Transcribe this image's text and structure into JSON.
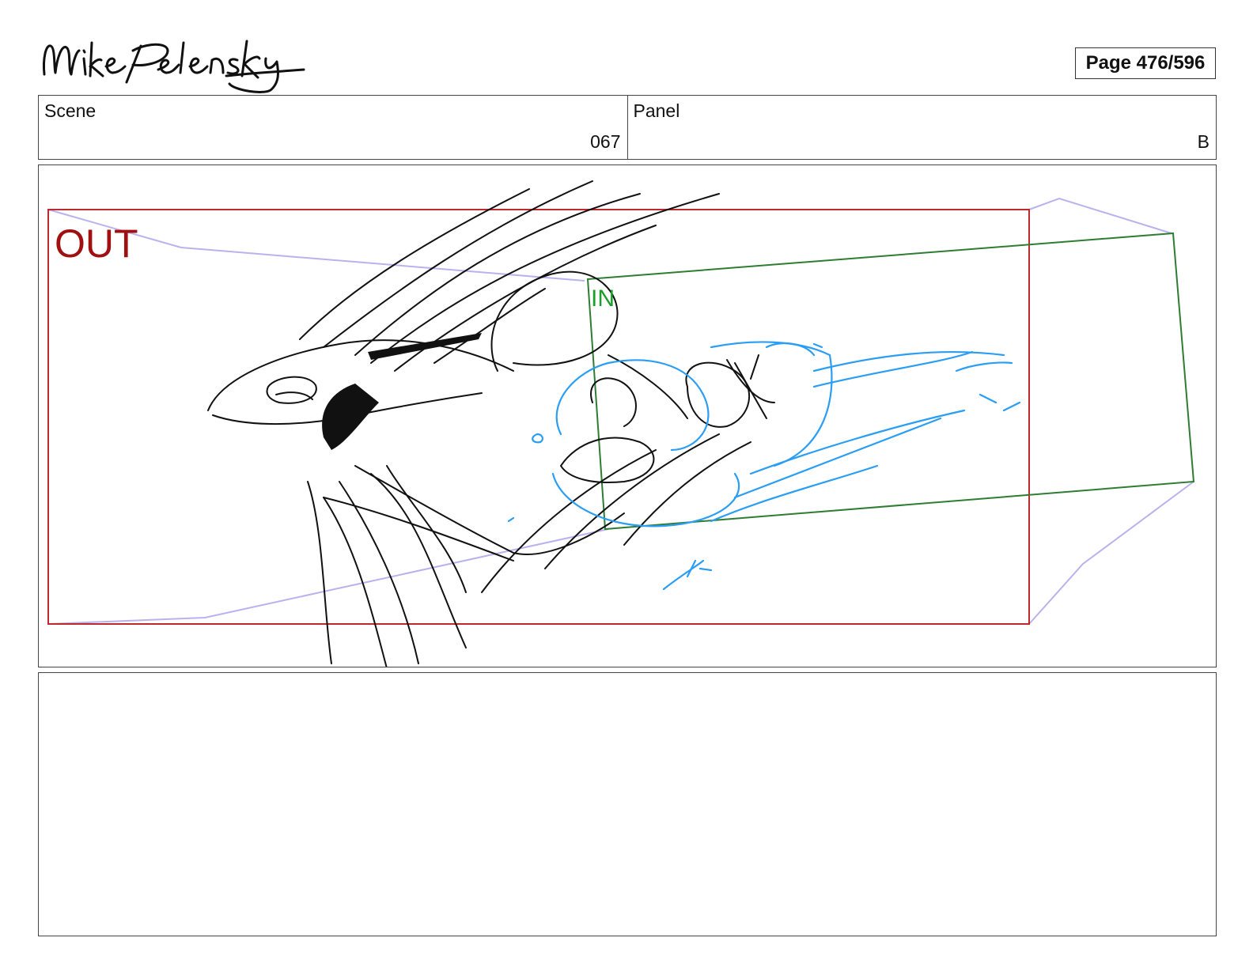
{
  "header": {
    "artist_signature": "Mike Pelensky",
    "page_label": "Page 476/596"
  },
  "info": {
    "scene_label": "Scene",
    "scene_value": "067",
    "panel_label": "Panel",
    "panel_value": "B"
  },
  "panel": {
    "out_label": "OUT",
    "in_label": "IN",
    "colors": {
      "out_frame": "#c0282b",
      "in_frame": "#2e7d32",
      "sketch_ink": "#111111",
      "effect_ink": "#2a9df4",
      "guide_lines": "#b9b2ee"
    }
  },
  "notes": {
    "text": ""
  }
}
